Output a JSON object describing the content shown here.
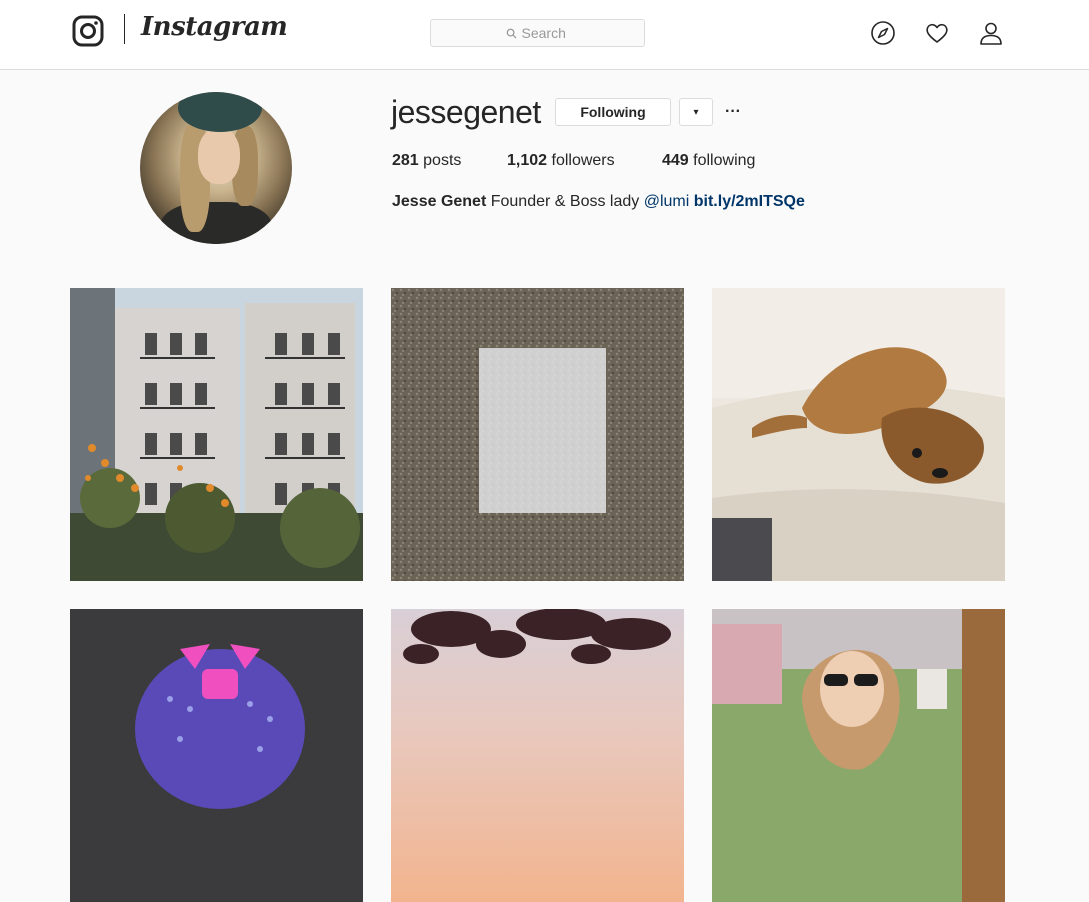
{
  "header": {
    "brand": "Instagram",
    "search_placeholder": "Search"
  },
  "nav": {
    "icons": [
      "compass-icon",
      "heart-icon",
      "person-icon"
    ]
  },
  "profile": {
    "username": "jessegenet",
    "following_button": "Following",
    "dropdown_glyph": "▾",
    "more_glyph": "···",
    "stats": {
      "posts_count": "281",
      "posts_label": "posts",
      "followers_count": "1,102",
      "followers_label": "followers",
      "following_count": "449",
      "following_label": "following"
    },
    "bio": {
      "full_name": "Jesse Genet",
      "text": "Founder & Boss lady",
      "mention": "@lumi",
      "link": "bit.ly/2mITSQe"
    }
  },
  "posts": [
    {
      "subject": "apartment-building"
    },
    {
      "subject": "white-square-on-asphalt"
    },
    {
      "subject": "dog-on-couch"
    },
    {
      "subject": "purple-backpack"
    },
    {
      "subject": "sunset-branches"
    },
    {
      "subject": "woman-with-sunglasses"
    }
  ],
  "colors": {
    "background": "#fafafa",
    "border": "#dbdbdb",
    "text": "#262626",
    "link": "#003569",
    "muted": "#999999"
  }
}
